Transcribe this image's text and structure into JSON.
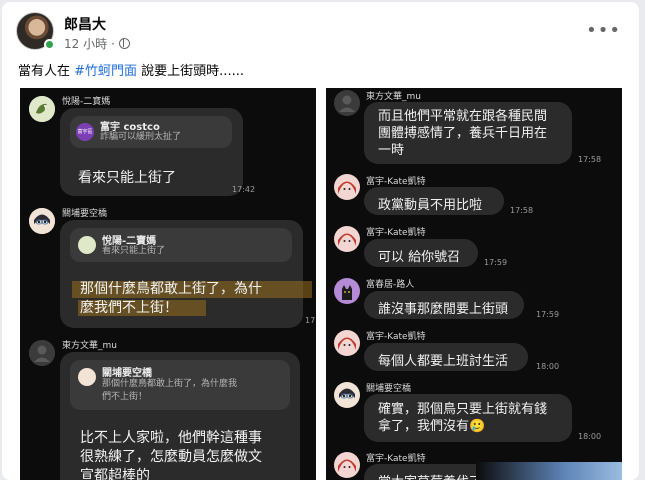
{
  "post": {
    "author": "郎昌大",
    "time": "12 小時",
    "more": "•••",
    "caption_before": "當有人在 ",
    "caption_tag": "#竹蚵門面",
    "caption_after": " 說要上街頭時......"
  },
  "left": {
    "m1": {
      "sender": "悅陽-二寶媽",
      "reply_name": "富宇 costco",
      "reply_text": "詐騙可以緩刑太扯了",
      "mini_label": "富宇區",
      "text": "看來只能上街了",
      "time": "17:42"
    },
    "m2": {
      "sender": "關埔要空橋",
      "reply_name": "悅陽-二寶媽",
      "reply_text": "看來只能上街了",
      "text_l1": "那個什麼鳥都敢上街了，為什",
      "text_l2": "麼我們不上街！",
      "time": "17"
    },
    "m3": {
      "sender": "東方文華_mu",
      "reply_name": "關埔要空橋",
      "reply_text_l1": "那個什麼鳥都敢上街了，為什麼我",
      "reply_text_l2": "們不上街！",
      "text_l1": "比不上人家啦，他們幹這種事",
      "text_l2": "很熟練了，怎麼動員怎麼做文",
      "text_l3": "宣都超棒的"
    }
  },
  "right": {
    "r1": {
      "sender": "東方文華_mu",
      "l1": "而且他們平常就在跟各種民間",
      "l2": "團體搏感情了，養兵千日用在",
      "l3": "一時",
      "time": "17:58"
    },
    "r2": {
      "sender": "富宇-Kate凱特",
      "text": "政黨動員不用比啦",
      "time": "17:58"
    },
    "r3": {
      "sender": "富宇-Kate凱特",
      "text": "可以 給你號召",
      "time": "17:59"
    },
    "r4": {
      "sender": "富春居-路人",
      "text": "誰沒事那麼閒要上街頭",
      "time": "17:59"
    },
    "r5": {
      "sender": "富宇-Kate凱特",
      "text": "每個人都要上班討生活",
      "time": "18:00"
    },
    "r6": {
      "sender": "關埔要空橋",
      "l1": "確實，那個鳥只要上街就有錢",
      "l2": "拿了，我們沒有",
      "emoji": "🥲",
      "time": "18:00"
    },
    "r7": {
      "sender": "富宇-Kate凱特",
      "text": "當大家草莓養伐了"
    }
  }
}
